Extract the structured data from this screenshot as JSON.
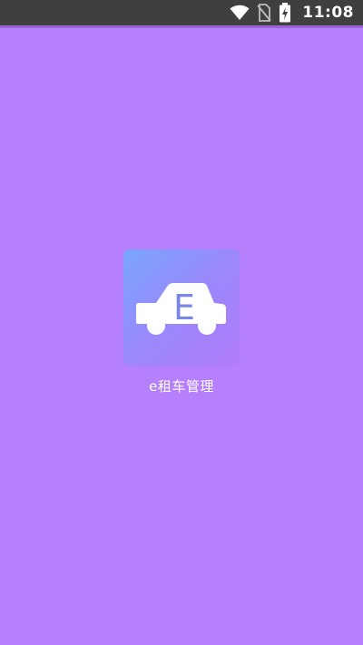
{
  "status_bar": {
    "time": "11:08",
    "icons": [
      "wifi-icon",
      "no-sim-icon",
      "battery-charging-icon"
    ]
  },
  "splash": {
    "logo_letter": "E",
    "app_name": "e租车管理",
    "colors": {
      "background": "#b67ffb",
      "icon_gradient_start": "#78a6fc",
      "icon_gradient_end": "#b07bfb",
      "car": "#ffffff",
      "letter": "#7b86e8"
    }
  }
}
